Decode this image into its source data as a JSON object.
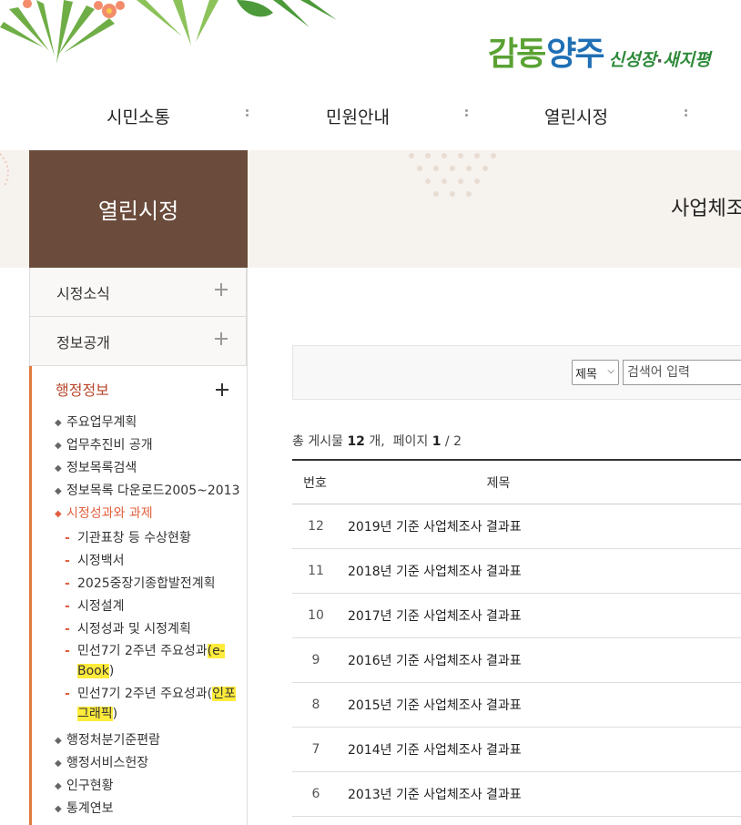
{
  "logo": {
    "main1": "감동",
    "main2": "양주",
    "sub1": "신성장",
    "dot": "·",
    "sub2": "새지평"
  },
  "gnb": [
    "시민소통",
    "민원안내",
    "열린시정"
  ],
  "band": {
    "section_title": "열린시정",
    "page_heading": "사업체조"
  },
  "lnb": {
    "top_items": [
      "시정소식",
      "정보공개"
    ],
    "active": "행정정보",
    "sub_before": [
      "주요업무계획",
      "업무추진비 공개",
      "정보목록검색",
      "정보목록 다운로드2005~2013"
    ],
    "sub_current": "시정성과와 과제",
    "sub2": [
      "기관표창 등 수상현황",
      "시정백서",
      "2025중장기종합발전계획",
      "시정설계",
      "시정성과 및 시정계획"
    ],
    "sub2_ebook": {
      "prefix": "민선7기 2주년 주요성과",
      "hl1": "(e-",
      "hl2": "Book",
      "suffix": ")"
    },
    "sub2_info": {
      "prefix": "민선7기 2주년 주요성과(",
      "hl1": "인포",
      "hl2": "그래픽",
      "suffix": ")"
    },
    "sub_after": [
      "행정처분기준편람",
      "행정서비스헌장",
      "인구현황",
      "통계연보"
    ]
  },
  "search": {
    "select_value": "제목",
    "placeholder": "검색어 입력"
  },
  "total": {
    "label1": "총 게시물",
    "count": "12",
    "unit": "개,",
    "label2": "페이지",
    "page": "1",
    "pages": "/ 2"
  },
  "table": {
    "headers": {
      "no": "번호",
      "title": "제목"
    },
    "rows": [
      {
        "no": "12",
        "title": "2019년 기준 사업체조사 결과표"
      },
      {
        "no": "11",
        "title": "2018년 기준 사업체조사 결과표"
      },
      {
        "no": "10",
        "title": "2017년 기준 사업체조사 결과표"
      },
      {
        "no": "9",
        "title": "2016년 기준 사업체조사 결과표"
      },
      {
        "no": "8",
        "title": "2015년 기준 사업체조사 결과표"
      },
      {
        "no": "7",
        "title": "2014년 기준 사업체조사 결과표"
      },
      {
        "no": "6",
        "title": "2013년 기준 사업체조사 결과표"
      }
    ]
  },
  "colors": {
    "brand_brown": "#6b4c3c",
    "accent_orange": "#e0603f",
    "band_bg": "#f6f2ee",
    "highlight": "#ffeb3b"
  }
}
